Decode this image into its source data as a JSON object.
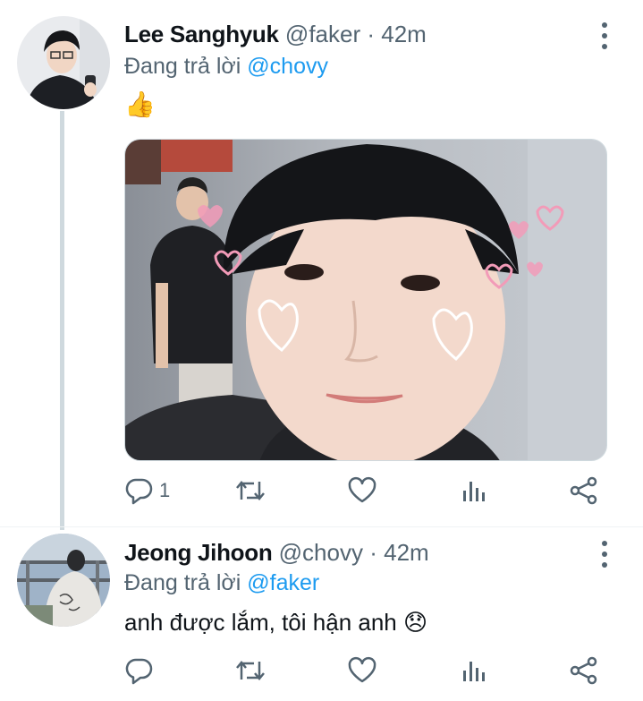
{
  "tweets": [
    {
      "name": "Lee Sanghyuk",
      "handle": "@faker",
      "separator": "·",
      "time": "42m",
      "reply_prefix": "Đang trả lời",
      "reply_to": "@chovy",
      "text": "👍",
      "has_media": true,
      "reply_count": "1"
    },
    {
      "name": "Jeong Jihoon",
      "handle": "@chovy",
      "separator": "·",
      "time": "42m",
      "reply_prefix": "Đang trả lời",
      "reply_to": "@faker",
      "text": "anh được lắm, tôi hận anh 😞",
      "has_media": false,
      "reply_count": ""
    }
  ],
  "colors": {
    "accent": "#1d9bf0",
    "secondary_text": "#536471",
    "thread_line": "#cfd9de"
  },
  "icons": [
    "more-icon",
    "reply-icon",
    "retweet-icon",
    "like-icon",
    "views-icon",
    "share-icon"
  ]
}
